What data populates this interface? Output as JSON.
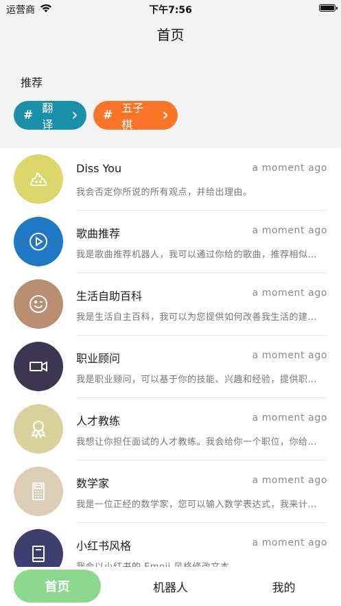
{
  "status_bar": {
    "carrier": "运营商",
    "time": "下午7:56"
  },
  "nav": {
    "title": "首页"
  },
  "recommend": {
    "label": "推荐",
    "chips": [
      {
        "hash": "#",
        "label": "翻译",
        "color": "#1a8fa8"
      },
      {
        "hash": "#",
        "label": "五子棋",
        "color": "#fb7528"
      }
    ]
  },
  "list": [
    {
      "title": "Diss You",
      "time": "a moment ago",
      "subtitle": "我会否定你所说的所有观点，并给出理由。",
      "avatar_color": "#dcd76b",
      "icon": "poop-icon"
    },
    {
      "title": "歌曲推荐",
      "time": "a moment ago",
      "subtitle": "我是歌曲推荐机器人，我可以通过你给的歌曲，推荐相似的歌曲。",
      "avatar_color": "#1f78c1",
      "icon": "play-icon"
    },
    {
      "title": "生活自助百科",
      "time": "a moment ago",
      "subtitle": "我是生活自主百科，我可以为您提供如何改善我生活的建议。",
      "avatar_color": "#b98f73",
      "icon": "wink-face-icon"
    },
    {
      "title": "职业顾问",
      "time": "a moment ago",
      "subtitle": "我是职业顾问，可以基于你的技能、兴趣和经验，提供职业建议。",
      "avatar_color": "#3c3650",
      "icon": "video-camera-icon"
    },
    {
      "title": "人才教练",
      "time": "a moment ago",
      "subtitle": "我想让你担任面试的人才教练。我会给你一个职位，你给出问题。",
      "avatar_color": "#d8d39c",
      "icon": "award-icon"
    },
    {
      "title": "数学家",
      "time": "a moment ago",
      "subtitle": "我是一位正经的数学家，您可以输入数学表达式，我来计算结果。",
      "avatar_color": "#dccfb5",
      "icon": "calculator-icon"
    },
    {
      "title": "小红书风格",
      "time": "a moment ago",
      "subtitle": "我会以小红书的 Emoji 风格修改文本",
      "avatar_color": "#3b3e6e",
      "icon": "book-icon"
    }
  ],
  "tabs": {
    "home": "首页",
    "robot": "机器人",
    "mine": "我的",
    "active_color": "#8bd88e"
  }
}
